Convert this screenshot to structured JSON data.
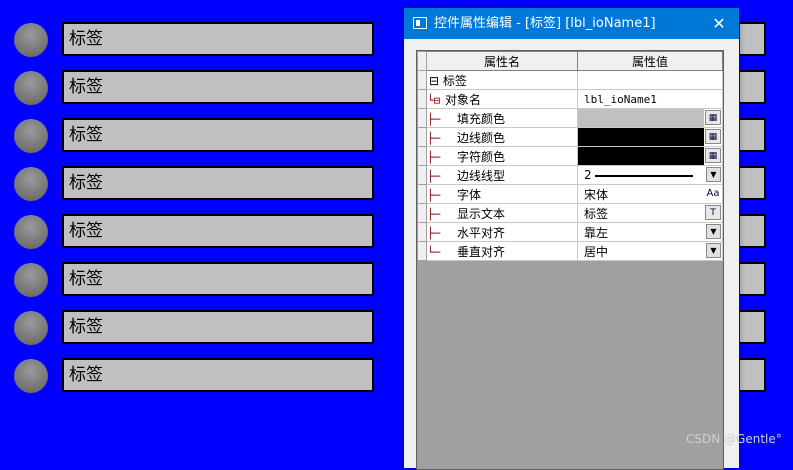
{
  "labels": [
    "标签",
    "标签",
    "标签",
    "标签",
    "标签",
    "标签",
    "标签",
    "标签"
  ],
  "dialog": {
    "title": "控件属性编辑 - [标签] [lbl_ioName1]",
    "close": "✕",
    "col_name": "属性名",
    "col_value": "属性值",
    "group": "⊟ 标签",
    "object": "对象名",
    "object_value": "lbl_ioName1",
    "fill": "填充颜色",
    "border": "边线颜色",
    "text_color": "字符颜色",
    "line_type": "边线线型",
    "line_type_value": "2",
    "font": "字体",
    "font_value": "宋体",
    "display_text": "显示文本",
    "display_text_value": "标签",
    "halign": "水平对齐",
    "halign_value": "靠左",
    "valign": "垂直对齐",
    "valign_value": "居中"
  },
  "colors": {
    "background": "#0000ff",
    "fill": "#c0c0c0",
    "border": "#000000",
    "text": "#000000",
    "titlebar": "#0078d7"
  },
  "watermark": "CSDN @Gentle°"
}
